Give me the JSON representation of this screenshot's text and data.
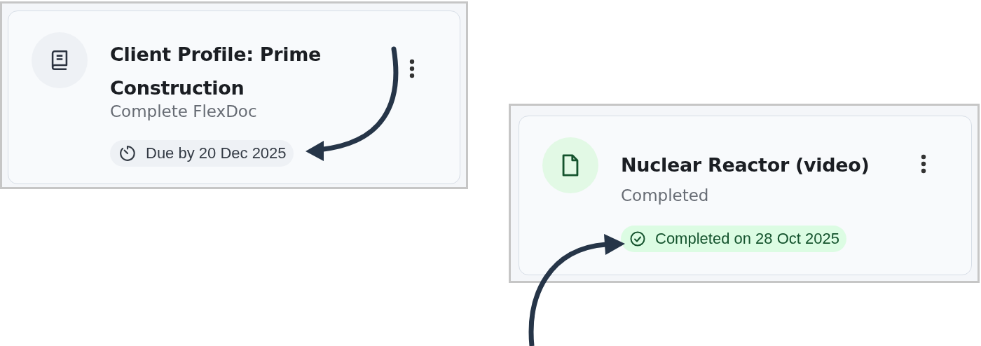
{
  "cards": [
    {
      "kind": "due",
      "title": "Client Profile: Prime Construction",
      "subtitle": "Complete FlexDoc",
      "badge": "Due by 20 Dec 2025"
    },
    {
      "kind": "completed",
      "title": "Nuclear Reactor (video)",
      "subtitle": "Completed",
      "badge": "Completed on 28 Oct 2025"
    }
  ]
}
